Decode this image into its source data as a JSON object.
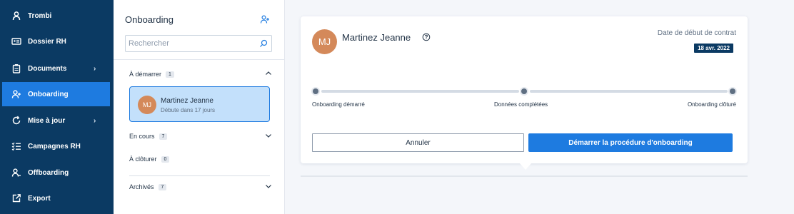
{
  "sidebar": {
    "items": [
      {
        "label": "Trombi",
        "icon": "user-icon",
        "active": false,
        "has_chevron": false
      },
      {
        "label": "Dossier RH",
        "icon": "id-card-icon",
        "active": false,
        "has_chevron": false
      },
      {
        "label": "Documents",
        "icon": "clipboard-icon",
        "active": false,
        "has_chevron": true
      },
      {
        "label": "Onboarding",
        "icon": "user-add-icon",
        "active": true,
        "has_chevron": false
      },
      {
        "label": "Mise à jour",
        "icon": "refresh-icon",
        "active": false,
        "has_chevron": true
      },
      {
        "label": "Campagnes RH",
        "icon": "checklist-icon",
        "active": false,
        "has_chevron": false
      },
      {
        "label": "Offboarding",
        "icon": "user-remove-icon",
        "active": false,
        "has_chevron": false
      },
      {
        "label": "Export",
        "icon": "export-icon",
        "active": false,
        "has_chevron": false
      }
    ]
  },
  "panel": {
    "title": "Onboarding",
    "search_placeholder": "Rechercher",
    "sections": {
      "to_start": {
        "label": "À démarrer",
        "count": "1",
        "expanded": true
      },
      "in_progress": {
        "label": "En cours",
        "count": "7",
        "expanded": false
      },
      "to_close": {
        "label": "À clôturer",
        "count": "0"
      },
      "archived": {
        "label": "Archivés",
        "count": "7",
        "expanded": false
      }
    },
    "candidate": {
      "initials": "MJ",
      "name": "Martinez Jeanne",
      "subtitle": "Débute dans 17 jours"
    }
  },
  "card": {
    "initials": "MJ",
    "name": "Martinez Jeanne",
    "contract_label": "Date de début de contrat",
    "contract_date": "18 avr. 2022",
    "steps": [
      "Onboarding démarré",
      "Données complétées",
      "Onboarding clôturé"
    ],
    "cancel_label": "Annuler",
    "start_label": "Démarrer la procédure d'onboarding"
  },
  "colors": {
    "sidebar_bg": "#0b3a63",
    "accent": "#1e7be0",
    "selected_card_bg": "#c3e0fb",
    "avatar": "#d4895a"
  }
}
